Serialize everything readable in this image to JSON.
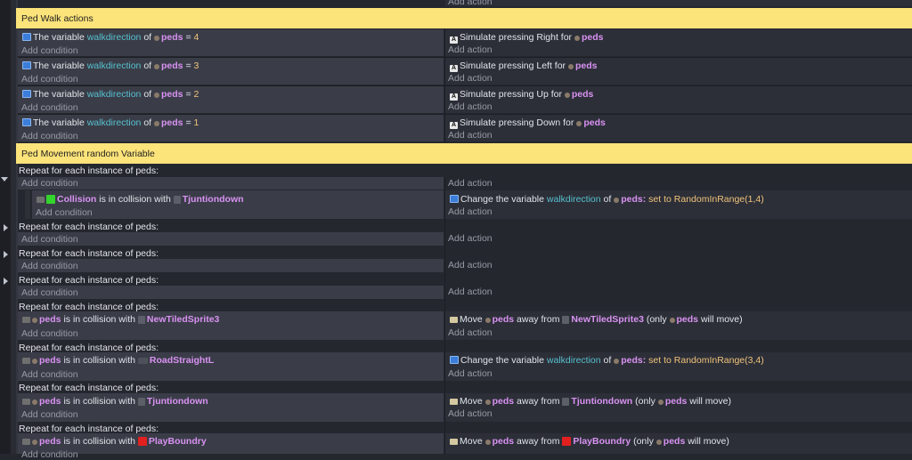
{
  "general": {
    "add_condition": "Add condition",
    "add_action": "Add action",
    "repeat_prefix": "Repeat for each instance of peds:",
    "of": "of",
    "is_in_collision_with": "is in collision with",
    "move_verb": "Move",
    "away_from": "away from",
    "only_open": "(only",
    "will_move": "will move)",
    "change_the_variable": "Change the variable",
    "set_to": "set to",
    "the_variable": "The variable",
    "peds": "peds",
    "peds_colon": "peds:",
    "equals": "="
  },
  "comments": {
    "walk": "Ped Walk actions",
    "movement": "Ped Movement random Variable"
  },
  "walk_rows": [
    {
      "variable": "walkdirection",
      "object": "peds",
      "value": "4",
      "action": "Simulate pressing Right for",
      "action_obj": "peds"
    },
    {
      "variable": "walkdirection",
      "object": "peds",
      "value": "3",
      "action": "Simulate pressing Left for",
      "action_obj": "peds"
    },
    {
      "variable": "walkdirection",
      "object": "peds",
      "value": "2",
      "action": "Simulate pressing Up for",
      "action_obj": "peds"
    },
    {
      "variable": "walkdirection",
      "object": "peds",
      "value": "1",
      "action": "Simulate pressing Down for",
      "action_obj": "peds"
    }
  ],
  "repeat_blocks": {
    "sub1": {
      "subject": "Collision",
      "target": "Tjuntiondown",
      "variable": "walkdirection",
      "expr": "RandomInRange(1,4)"
    },
    "sub5": {
      "target": "NewTiledSprite3"
    },
    "sub6": {
      "target": "RoadStraightL",
      "variable": "walkdirection",
      "expr": "RandomInRange(3,4)"
    },
    "sub7": {
      "target": "Tjuntiondown"
    },
    "sub8": {
      "target": "PlayBoundry"
    }
  },
  "icons": {
    "variable": "variable-icon",
    "keyboard": "keyboard-icon",
    "ped": "ped-object-icon",
    "move": "move-icon"
  },
  "colors": {
    "comment": "#fce37a",
    "object": "#d992f2",
    "variable": "#57c0cf",
    "expression": "#f0c37a",
    "background": "#25272f"
  }
}
